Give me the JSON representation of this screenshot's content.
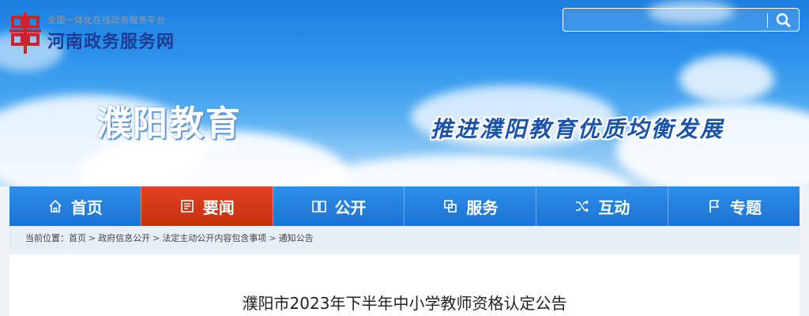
{
  "header": {
    "logo_sub": "全国一体化在线政务服务平台",
    "logo_main": "河南政务服务网",
    "search_placeholder": "",
    "site_title": "濮阳教育",
    "site_subtitle": "Education in Puyang",
    "slogan": "推进濮阳教育优质均衡发展"
  },
  "nav": {
    "items": [
      {
        "label": "首页",
        "icon": "home-icon"
      },
      {
        "label": "要闻",
        "icon": "news-icon",
        "active": true
      },
      {
        "label": "公开",
        "icon": "book-icon"
      },
      {
        "label": "服务",
        "icon": "service-icon"
      },
      {
        "label": "互动",
        "icon": "shuffle-icon"
      },
      {
        "label": "专题",
        "icon": "flag-icon"
      }
    ]
  },
  "breadcrumb": {
    "prefix": "当前位置：",
    "items": [
      "首页",
      "政府信息公开",
      "法定主动公开内容包含事项",
      "通知公告"
    ],
    "separator": ">"
  },
  "article": {
    "title": "濮阳市2023年下半年中小学教师资格认定公告"
  },
  "colors": {
    "nav_bg": "#1c72d3",
    "nav_active": "#d23a17",
    "logo_red": "#c8262c",
    "logo_blue": "#1f3a93",
    "slogan": "#1b53a8"
  }
}
